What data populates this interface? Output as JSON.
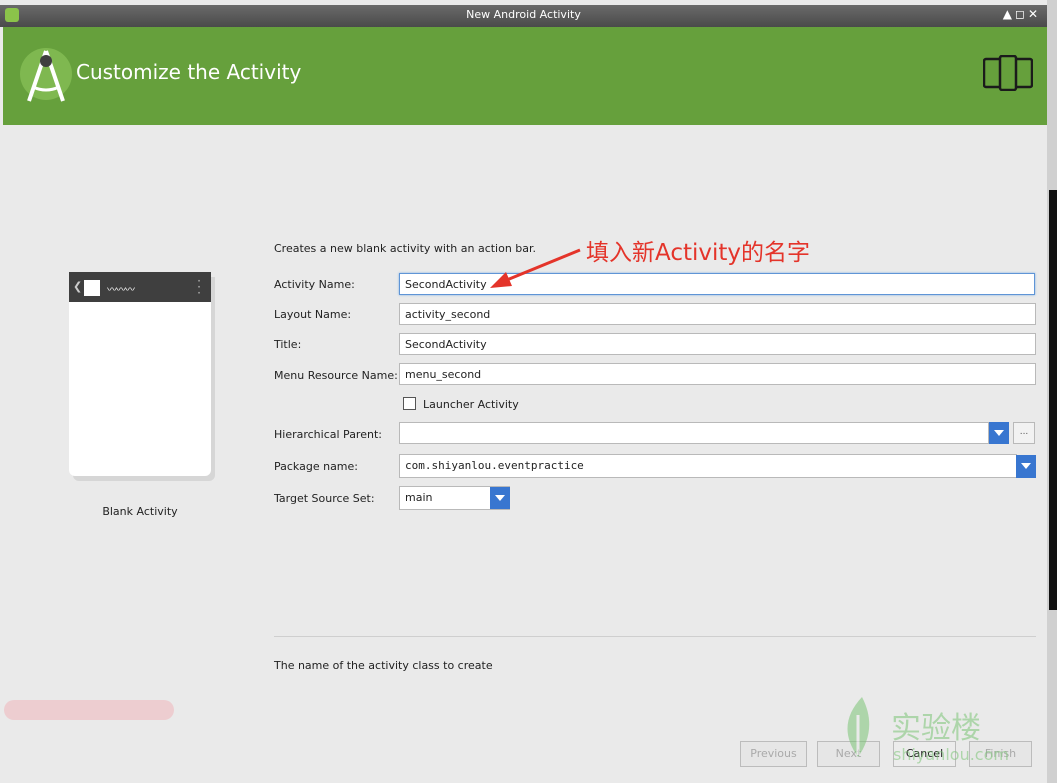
{
  "window": {
    "title": "New Android Activity",
    "controls": "▲◻✕"
  },
  "header": {
    "heading": "Customize the Activity"
  },
  "preview": {
    "label": "Blank Activity"
  },
  "form": {
    "description": "Creates a new blank activity with an action bar.",
    "activity_name": {
      "label": "Activity Name:",
      "value": "SecondActivity"
    },
    "layout_name": {
      "label": "Layout Name:",
      "value": "activity_second"
    },
    "title": {
      "label": "Title:",
      "value": "SecondActivity"
    },
    "menu_resource_name": {
      "label": "Menu Resource Name:",
      "value": "menu_second"
    },
    "launcher_activity": {
      "label": "Launcher Activity",
      "checked": false
    },
    "hierarchical_parent": {
      "label": "Hierarchical Parent:",
      "value": "",
      "browse_label": "..."
    },
    "package_name": {
      "label": "Package name:",
      "value": "com.shiyanlou.eventpractice"
    },
    "target_source_set": {
      "label": "Target Source Set:",
      "value": "main"
    }
  },
  "hint": "The name of the activity class to create",
  "buttons": {
    "previous": "Previous",
    "next": "Next",
    "cancel": "Cancel",
    "finish": "Finish"
  },
  "annotation": "填入新Activity的名字",
  "watermark": {
    "text": "实验楼",
    "sub": "shiyanlou.com"
  },
  "colors": {
    "header": "#66a03c",
    "accent": "#3876d0",
    "annotation": "#e4342a"
  }
}
